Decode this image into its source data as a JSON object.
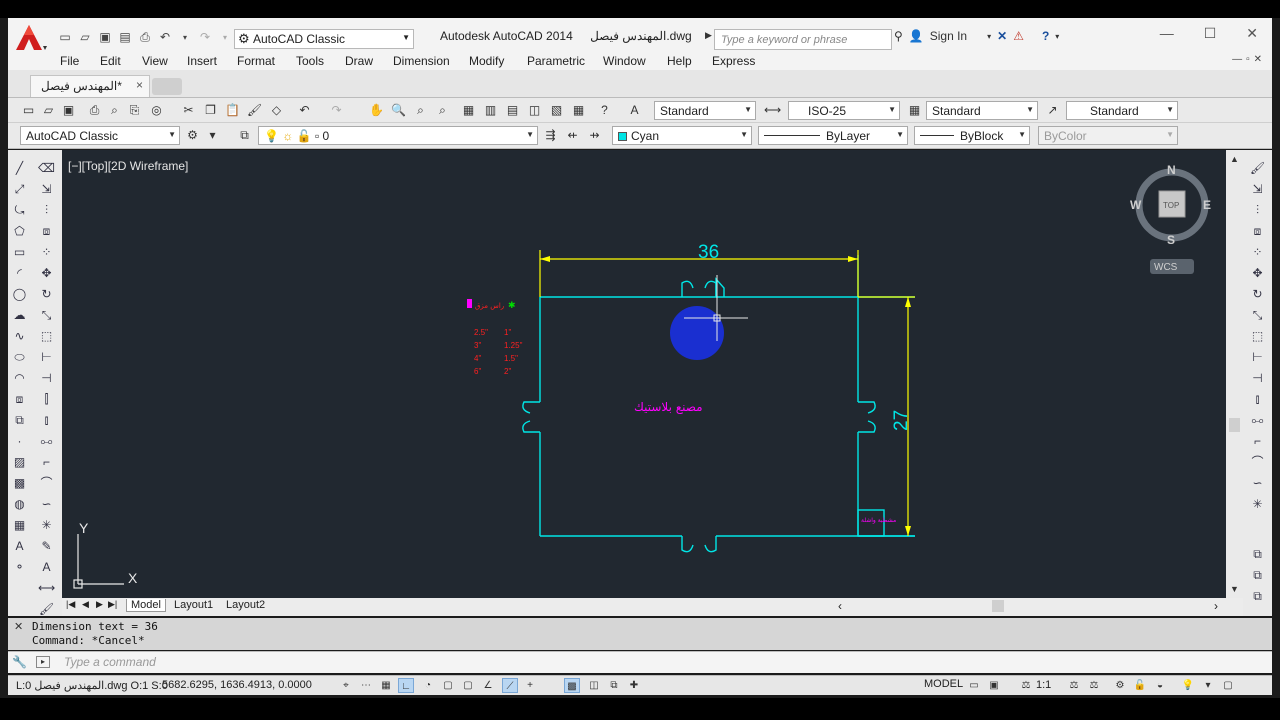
{
  "app": {
    "window_title": "Autodesk AutoCAD 2014",
    "file_name": "المهندس فيصل.dwg",
    "workspace": "AutoCAD Classic",
    "search_placeholder": "Type a keyword or phrase",
    "sign_in": "Sign In"
  },
  "menus": [
    "File",
    "Edit",
    "View",
    "Insert",
    "Format",
    "Tools",
    "Draw",
    "Dimension",
    "Modify",
    "Parametric",
    "Window",
    "Help",
    "Express"
  ],
  "doc_tab": {
    "label": "المهندس فيصل*",
    "close": "×"
  },
  "toolbar_styles": {
    "text_style": "Standard",
    "dim_style": "ISO-25",
    "table_style": "Standard",
    "mleader_style": "Standard"
  },
  "toolbar_layers": {
    "workspace": "AutoCAD Classic",
    "layer": "0",
    "color": "Cyan",
    "linetype": "ByLayer",
    "lineweight": "ByBlock",
    "plotstyle": "ByColor"
  },
  "viewport": {
    "label": "[−][Top][2D Wireframe]",
    "viewcube": {
      "n": "N",
      "s": "S",
      "e": "E",
      "w": "W",
      "face": "TOP",
      "wcs": "WCS"
    },
    "ucs": {
      "x": "X",
      "y": "Y"
    }
  },
  "drawing": {
    "dim_width": "36",
    "dim_height": "27",
    "factory_label": "مصنع بلاستيك",
    "legend_title": "راس مزق",
    "legend_rows": [
      [
        "2.5\"",
        "1\""
      ],
      [
        "3\"",
        "1.25\""
      ],
      [
        "4\"",
        "1.5\""
      ],
      [
        "6\"",
        "2\""
      ]
    ],
    "corner_label": "مشطبة واشلة",
    "colors": {
      "wall": "#00e6e6",
      "dimension": "#ffff00",
      "magenta": "#ff00ff",
      "circle": "#1a2fd0",
      "legend": "#ff2020",
      "green": "#00dd00"
    }
  },
  "layout_tabs": [
    "Model",
    "Layout1",
    "Layout2"
  ],
  "command": {
    "history": [
      "Dimension text = 36",
      "Command: *Cancel*"
    ],
    "placeholder": "Type a command"
  },
  "status": {
    "coords": "5682.6295, 1636.4913, 0.0000",
    "file_info": "L:0 المهندس فيصل.dwg O:1 S:0",
    "model": "MODEL",
    "scale": "1:1"
  }
}
